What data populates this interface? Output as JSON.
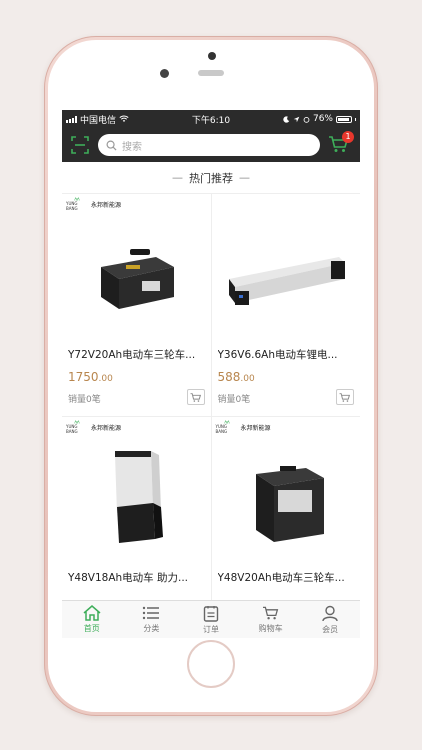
{
  "status_bar": {
    "carrier": "中国电信",
    "time": "下午6:10",
    "battery": "76%"
  },
  "header": {
    "search_placeholder": "搜索",
    "cart_badge": "1"
  },
  "section": {
    "title": "热门推荐"
  },
  "products": [
    {
      "title": "Y72V20Ah电动车三轮车...",
      "price_int": "1750",
      "price_dec": ".00",
      "sales": "销量0笔"
    },
    {
      "title": "Y36V6.6Ah电动车锂电...",
      "price_int": "588",
      "price_dec": ".00",
      "sales": "销量0笔"
    },
    {
      "title": "Y48V18Ah电动车 助力...",
      "price_int": "",
      "price_dec": "",
      "sales": ""
    },
    {
      "title": "Y48V20Ah电动车三轮车...",
      "price_int": "",
      "price_dec": "",
      "sales": ""
    }
  ],
  "logo": {
    "brand": "永邦新能源",
    "mark": "YUNG BANG"
  },
  "tabs": [
    {
      "label": "首页",
      "icon": "home-icon"
    },
    {
      "label": "分类",
      "icon": "list-icon"
    },
    {
      "label": "订单",
      "icon": "order-icon"
    },
    {
      "label": "购物车",
      "icon": "cart-icon"
    },
    {
      "label": "会员",
      "icon": "user-icon"
    }
  ],
  "colors": {
    "accent": "#3eae5a",
    "price": "#b8864e",
    "badge": "#e8372c",
    "bar": "#2b2b2b"
  }
}
